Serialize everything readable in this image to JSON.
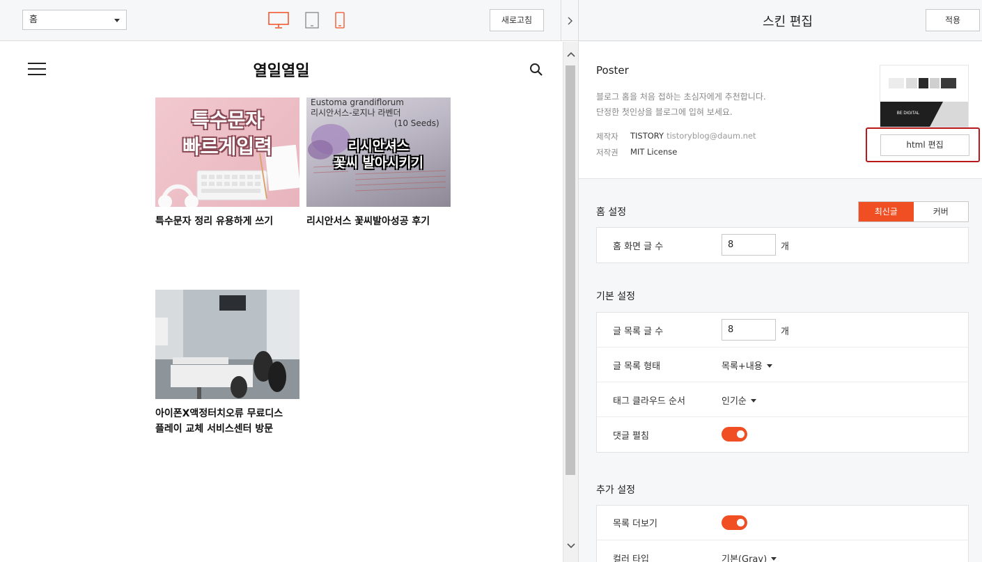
{
  "toolbar": {
    "page_select": "홈",
    "refresh_label": "새로고침"
  },
  "preview": {
    "blog_title": "열일열일",
    "posts": [
      {
        "title": "특수문자 정리 유용하게 쓰기",
        "thumb_text": [
          "특수문자",
          "빠르게입력"
        ]
      },
      {
        "title": "리시안서스 꽃씨발아성공 후기",
        "thumb_text": [
          "Eustoma grandiflorum",
          "리시안서스-로지나 라벤더",
          "(10 Seeds)",
          "리시안셔스",
          "꽃씨 발아시키기"
        ]
      },
      {
        "title": "아이폰X액정터치오류 무료디스플레이 교체 서비스센터 방문",
        "title_lines": [
          "아이폰X액정터치오류 무료디스",
          "플레이 교체 서비스센터 방문"
        ]
      }
    ]
  },
  "panel": {
    "title": "스킨 편집",
    "apply_label": "적용",
    "skin": {
      "name": "Poster",
      "desc1": "블로그 홈을 처음 접하는 초심자에게 추천합니다.",
      "desc2": "단정한 첫인상을 블로그에 입혀 보세요.",
      "maker_label": "제작자",
      "maker": "TISTORY",
      "maker_email": "tistoryblog@daum.net",
      "license_label": "저작권",
      "license": "MIT License",
      "html_edit_label": "html 편집",
      "thumb_caption": "BE DIGITAL"
    },
    "home": {
      "title": "홈 설정",
      "seg_latest": "최신글",
      "seg_cover": "커버",
      "count_label": "홈 화면 글 수",
      "count_value": "8",
      "unit": "개"
    },
    "basic": {
      "title": "기본 설정",
      "list_count_label": "글 목록 글 수",
      "list_count_value": "8",
      "unit": "개",
      "list_type_label": "글 목록 형태",
      "list_type_value": "목록+내용",
      "tag_order_label": "태그 클라우드 순서",
      "tag_order_value": "인기순",
      "comment_label": "댓글 펼침",
      "comment_on": true
    },
    "extra": {
      "title": "추가 설정",
      "more_label": "목록 더보기",
      "more_on": true,
      "color_label": "컬러 타입",
      "color_value": "기본(Gray)"
    }
  },
  "colors": {
    "accent": "#f04e23",
    "highlight_frame": "#b9191c"
  }
}
